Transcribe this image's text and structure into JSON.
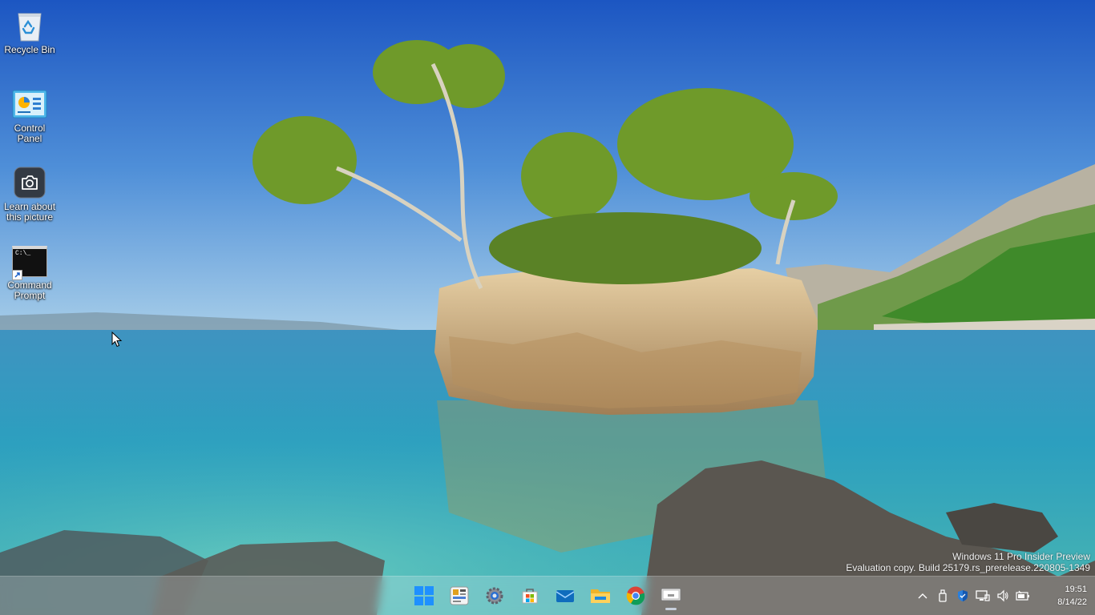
{
  "desktop": {
    "icons": [
      {
        "label": "Recycle Bin",
        "icon": "recycle-bin-icon"
      },
      {
        "label": "Control\nPanel",
        "icon": "control-panel-icon"
      },
      {
        "label": "Learn about\nthis picture",
        "icon": "camera-icon"
      },
      {
        "label": "Command\nPrompt",
        "icon": "command-prompt-icon"
      }
    ],
    "cmd_glyph": "C:\\_"
  },
  "watermark": {
    "line1": "Windows 11 Pro Insider Preview",
    "line2": "Evaluation copy. Build 25179.rs_prerelease.220805-1349"
  },
  "taskbar": {
    "apps": [
      {
        "name": "start-button",
        "icon": "windows-logo-icon"
      },
      {
        "name": "widgets-button",
        "icon": "widgets-icon"
      },
      {
        "name": "settings-button",
        "icon": "gear-icon"
      },
      {
        "name": "microsoft-store-button",
        "icon": "store-icon"
      },
      {
        "name": "mail-button",
        "icon": "mail-icon"
      },
      {
        "name": "file-explorer-button",
        "icon": "folder-icon"
      },
      {
        "name": "chrome-button",
        "icon": "chrome-icon"
      },
      {
        "name": "app-button",
        "icon": "monitor-app-icon",
        "active": true
      }
    ],
    "tray": {
      "icons": [
        "chevron-up-icon",
        "usb-icon",
        "defender-shield-icon",
        "network-icon",
        "volume-icon",
        "battery-icon"
      ]
    },
    "clock": {
      "time": "19:51",
      "date": "8/14/22"
    }
  },
  "colors": {
    "sky_top": "#1f5cc4",
    "sky_bottom": "#8fc0e8",
    "sea": "#2f9fc0",
    "accent": "#0078d4"
  }
}
